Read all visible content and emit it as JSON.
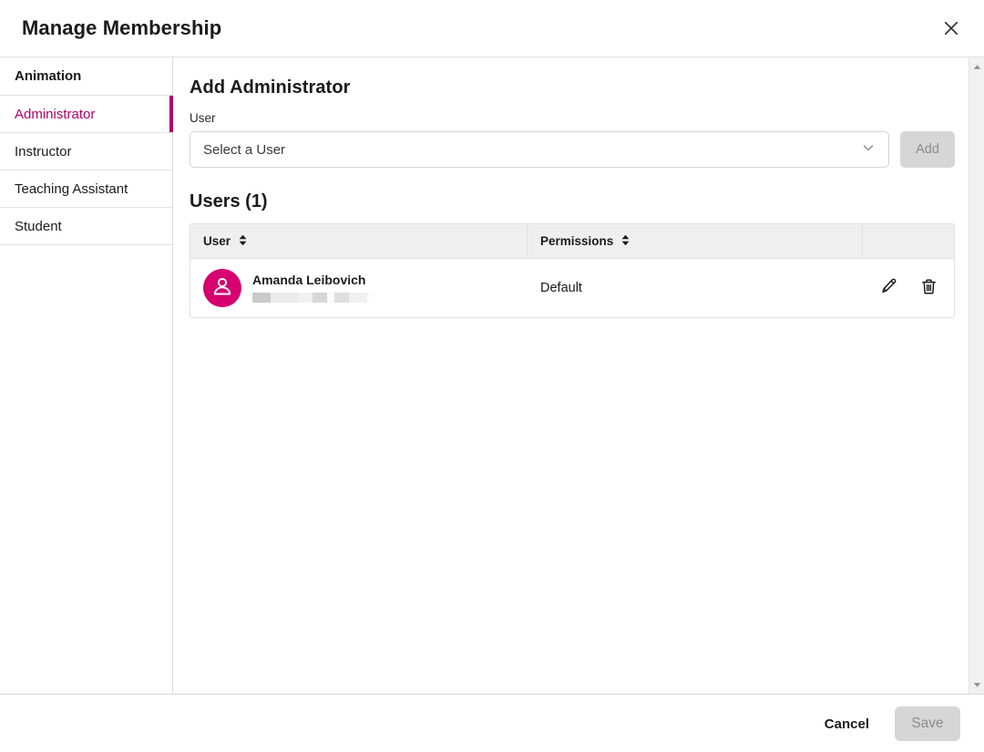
{
  "dialog": {
    "title": "Manage Membership",
    "close_icon": "close-icon"
  },
  "sidebar": {
    "group_title": "Animation",
    "items": [
      {
        "label": "Administrator",
        "selected": true
      },
      {
        "label": "Instructor",
        "selected": false
      },
      {
        "label": "Teaching Assistant",
        "selected": false
      },
      {
        "label": "Student",
        "selected": false
      }
    ],
    "accent_color": "#b3006b"
  },
  "main": {
    "section_title": "Add Administrator",
    "user_field": {
      "label": "User",
      "value": "Select a User",
      "placeholder": "Select a User",
      "chevron_icon": "chevron-down-icon"
    },
    "add_button": {
      "label": "Add",
      "disabled": true
    },
    "users_heading": "Users (1)",
    "table": {
      "columns": [
        {
          "label": "User",
          "sort_icon": "sort-updown-icon"
        },
        {
          "label": "Permissions",
          "sort_icon": "sort-updown-icon"
        },
        {
          "label": ""
        }
      ],
      "rows": [
        {
          "avatar_icon": "person-avatar-icon",
          "avatar_color": "#d6006e",
          "name": "Amanda Leibovich",
          "secondary_redacted": true,
          "permissions": "Default",
          "edit_icon": "pencil-edit-icon",
          "delete_icon": "trash-delete-icon"
        }
      ]
    }
  },
  "scrollbar": {
    "up_icon": "scroll-up-arrow-icon",
    "down_icon": "scroll-down-arrow-icon"
  },
  "footer": {
    "cancel_label": "Cancel",
    "save_label": "Save",
    "save_disabled": true
  }
}
